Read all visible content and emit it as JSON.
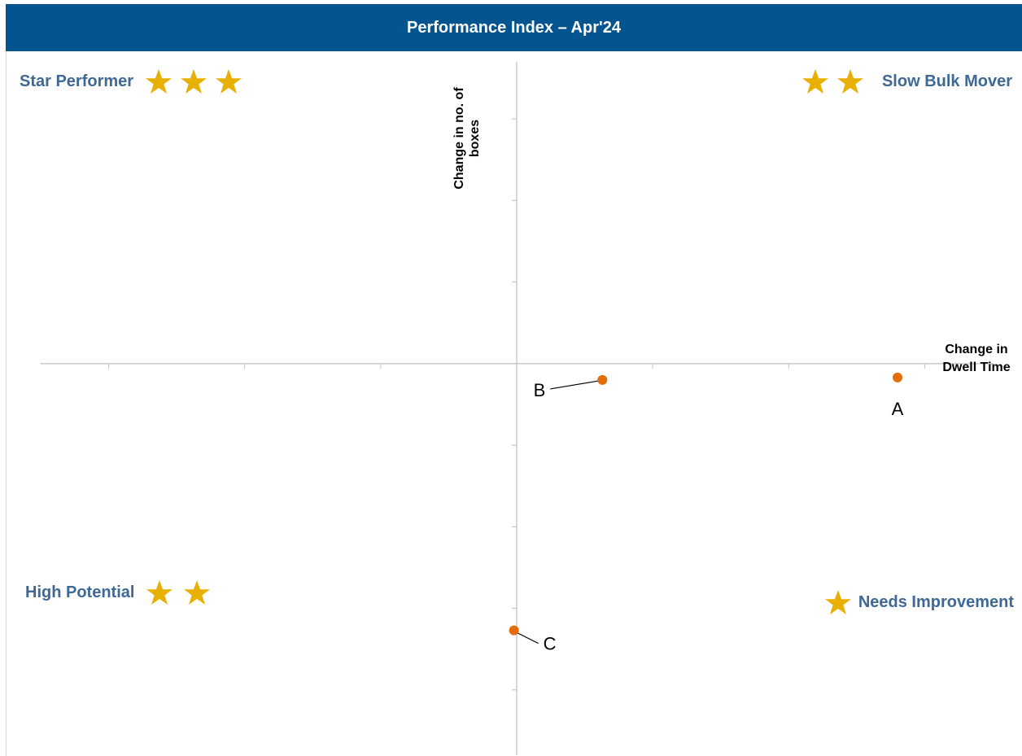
{
  "header": {
    "title": "Performance Index – Apr'24",
    "background": "#045490"
  },
  "quadrants": {
    "top_left": {
      "label": "Star Performer",
      "stars": 3
    },
    "top_right": {
      "label": "Slow Bulk Mover",
      "stars": 2
    },
    "bottom_left": {
      "label": "High Potential",
      "stars": 2
    },
    "bottom_right": {
      "label": "Needs Improvement",
      "stars": 1
    }
  },
  "colors": {
    "label_text": "#3f6894",
    "star": "#e8b005",
    "point": "#e46c0a",
    "axis": "#bfbfbf"
  },
  "chart_data": {
    "type": "scatter",
    "title": "Performance Index – Apr'24",
    "xlabel": "Change in Dwell Time",
    "ylabel": "Change in no. of boxes",
    "xlim": [
      -3.5,
      3.5
    ],
    "ylim": [
      -4.8,
      3.7
    ],
    "tick_labels": "none",
    "grid": false,
    "legend": "none",
    "points": [
      {
        "label": "A",
        "x": 2.8,
        "y": -0.17
      },
      {
        "label": "B",
        "x": 0.63,
        "y": -0.2
      },
      {
        "label": "C",
        "x": -0.02,
        "y": -3.27
      }
    ]
  }
}
